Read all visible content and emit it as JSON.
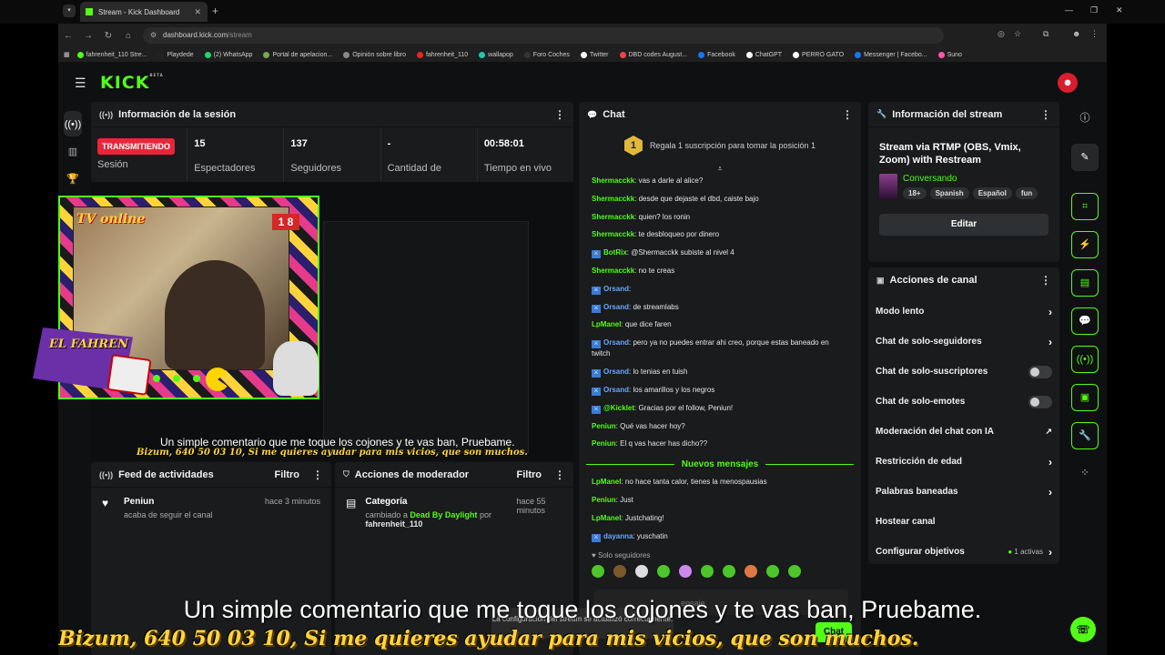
{
  "browser": {
    "tab_title": "Stream - Kick Dashboard",
    "url_host": "dashboard.kick.com",
    "url_path": "/stream",
    "bookmarks": [
      "fahrenheit_110 Stre...",
      "Playdede",
      "(2) WhatsApp",
      "Portal de apelacion...",
      "Opinión sobre libro",
      "fahrenheit_110",
      "wallapop",
      "Foro Coches",
      "Twitter",
      "DBD codes August...",
      "Facebook",
      "ChatGPT",
      "PERRO GATO",
      "Messenger | Facebo...",
      "Suno"
    ]
  },
  "header": {
    "logo": "KICK",
    "logo_tag": "BETA"
  },
  "session": {
    "title": "Información de la sesión",
    "status": "TRANSMITIENDO",
    "status_label": "Sesión",
    "viewers": "15",
    "viewers_label": "Espectadores",
    "followers": "137",
    "followers_label": "Seguidores",
    "subs": "-",
    "subs_label": "Cantidad de suscripciones",
    "uptime": "00:58:01",
    "uptime_label": "Tiempo en vivo"
  },
  "overlay": {
    "tv_label": "TV online",
    "tv_number": "1 8",
    "fahren_label": "EL FAHREN",
    "mini_subtitle": "Un simple comentario que me toque los cojones y te vas ban, Pruebame.",
    "mini_bizum": "Bizum, 640 50 03 10, Si me quieres ayudar para mis vicios, que son muchos."
  },
  "chat": {
    "title": "Chat",
    "promo": "Regala 1 suscripción para tomar la posición 1",
    "promo_rank": "1",
    "messages": [
      {
        "user": "Shermacckk",
        "text": "vas a darle al alice?"
      },
      {
        "user": "Shermacckk",
        "text": "desde que dejaste el dbd, caiste bajo"
      },
      {
        "user": "Shermacckk",
        "text": "quien? los ronin"
      },
      {
        "user": "Shermacckk",
        "text": "te desbloqueo por dinero"
      },
      {
        "user": "BotRix",
        "text": "@Shermacckk subiste al nivel 4"
      },
      {
        "user": "Shermacckk",
        "text": "no te creas"
      },
      {
        "user": "Orsand",
        "text": ""
      },
      {
        "user": "Orsand",
        "text": "de streamlabs"
      },
      {
        "user": "LpManel",
        "text": "que dice faren"
      },
      {
        "user": "Orsand",
        "text": "pero ya no puedes entrar ahi creo, porque estas baneado en twitch"
      },
      {
        "user": "Orsand",
        "text": "lo tenias en tuish"
      },
      {
        "user": "Orsand",
        "text": "los amarillos y los negros"
      },
      {
        "user": "@Kicklet",
        "text": "Gracias por el follow, Peniun!"
      },
      {
        "user": "Peniun",
        "text": "Qué vas hacer hoy?"
      },
      {
        "user": "Peniun",
        "text": "El q vas hacer has dicho??"
      }
    ],
    "new_label": "Nuevos mensajes",
    "new_messages": [
      {
        "user": "LpManel",
        "text": "no hace tanta calor, tienes la menospausias"
      },
      {
        "user": "Peniun",
        "text": "Just"
      },
      {
        "user": "LpManel",
        "text": "Justchating!"
      },
      {
        "user": "dayanna",
        "text": "yuschatin"
      }
    ],
    "followers_only": "Solo seguidores",
    "input_placeholder": "ensaje",
    "send_label": "Chat"
  },
  "stream_info": {
    "title": "Información del stream",
    "stream_title": "Stream via RTMP (OBS, Vmix, Zoom) with Restream",
    "category": "Conversando",
    "tags": [
      "18+",
      "Spanish",
      "Español",
      "fun"
    ],
    "edit_label": "Editar"
  },
  "channel_actions": {
    "title": "Acciones de canal",
    "items": [
      {
        "label": "Modo lento",
        "kind": "arrow"
      },
      {
        "label": "Chat de solo-seguidores",
        "kind": "arrow"
      },
      {
        "label": "Chat de solo-suscriptores",
        "kind": "toggle"
      },
      {
        "label": "Chat de solo-emotes",
        "kind": "toggle"
      },
      {
        "label": "Moderación del chat con IA",
        "kind": "external"
      },
      {
        "label": "Restricción de edad",
        "kind": "arrow"
      },
      {
        "label": "Palabras baneadas",
        "kind": "arrow"
      },
      {
        "label": "Hostear canal",
        "kind": "none"
      },
      {
        "label": "Configurar objetivos",
        "kind": "arrow"
      }
    ],
    "goals_active": "1 activas"
  },
  "activity_feed": {
    "title": "Feed de actividades",
    "filter": "Filtro",
    "user": "Peniun",
    "action": "acaba de seguir el canal",
    "time": "hace 3 minutos"
  },
  "mod_actions": {
    "title": "Acciones de moderador",
    "filter": "Filtro",
    "item": "Categoría",
    "pre": "cambiado a",
    "value": "Dead By Daylight",
    "mid": "por",
    "by": "fahrenheit_110",
    "time": "hace 55 minutos"
  },
  "toast": {
    "text": "La configuración del stream se actualizó correctamente."
  },
  "video_subtitle": "Un simple comentario que me toque los cojones y te vas ban, Pruebame.",
  "video_bizum": "Bizum, 640 50 03 10, Si me quieres ayudar para mis vicios, que son muchos.",
  "colors": {
    "accent": "#53fc18",
    "live": "#e8263b",
    "panel": "#191b1c"
  }
}
